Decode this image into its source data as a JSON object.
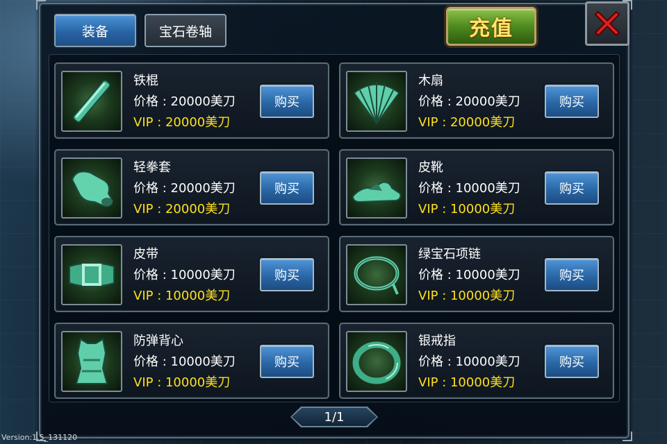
{
  "tabs": [
    {
      "label": "装备",
      "active": true
    },
    {
      "label": "宝石卷轴",
      "active": false
    }
  ],
  "recharge_label": "充值",
  "items": [
    {
      "name": "铁棍",
      "price": "价格 : 20000美刀",
      "vip": "VIP : 20000美刀",
      "buy_label": "购买",
      "icon": "iron-rod-icon"
    },
    {
      "name": "木扇",
      "price": "价格 : 20000美刀",
      "vip": "VIP : 20000美刀",
      "buy_label": "购买",
      "icon": "wooden-fan-icon"
    },
    {
      "name": "轻拳套",
      "price": "价格 : 20000美刀",
      "vip": "VIP : 20000美刀",
      "buy_label": "购买",
      "icon": "glove-icon"
    },
    {
      "name": "皮靴",
      "price": "价格 : 10000美刀",
      "vip": "VIP : 10000美刀",
      "buy_label": "购买",
      "icon": "boot-icon"
    },
    {
      "name": "皮带",
      "price": "价格 : 10000美刀",
      "vip": "VIP : 10000美刀",
      "buy_label": "购买",
      "icon": "belt-icon"
    },
    {
      "name": "绿宝石项链",
      "price": "价格 : 10000美刀",
      "vip": "VIP : 10000美刀",
      "buy_label": "购买",
      "icon": "necklace-icon"
    },
    {
      "name": "防弹背心",
      "price": "价格 : 10000美刀",
      "vip": "VIP : 10000美刀",
      "buy_label": "购买",
      "icon": "vest-icon"
    },
    {
      "name": "银戒指",
      "price": "价格 : 10000美刀",
      "vip": "VIP : 10000美刀",
      "buy_label": "购买",
      "icon": "ring-icon"
    }
  ],
  "pager": "1/1",
  "version": "Version:1.5_131120",
  "colors": {
    "accent_blue": "#2a67a6",
    "vip_yellow": "#ffe01a",
    "recharge_green": "#4e8a1e"
  }
}
